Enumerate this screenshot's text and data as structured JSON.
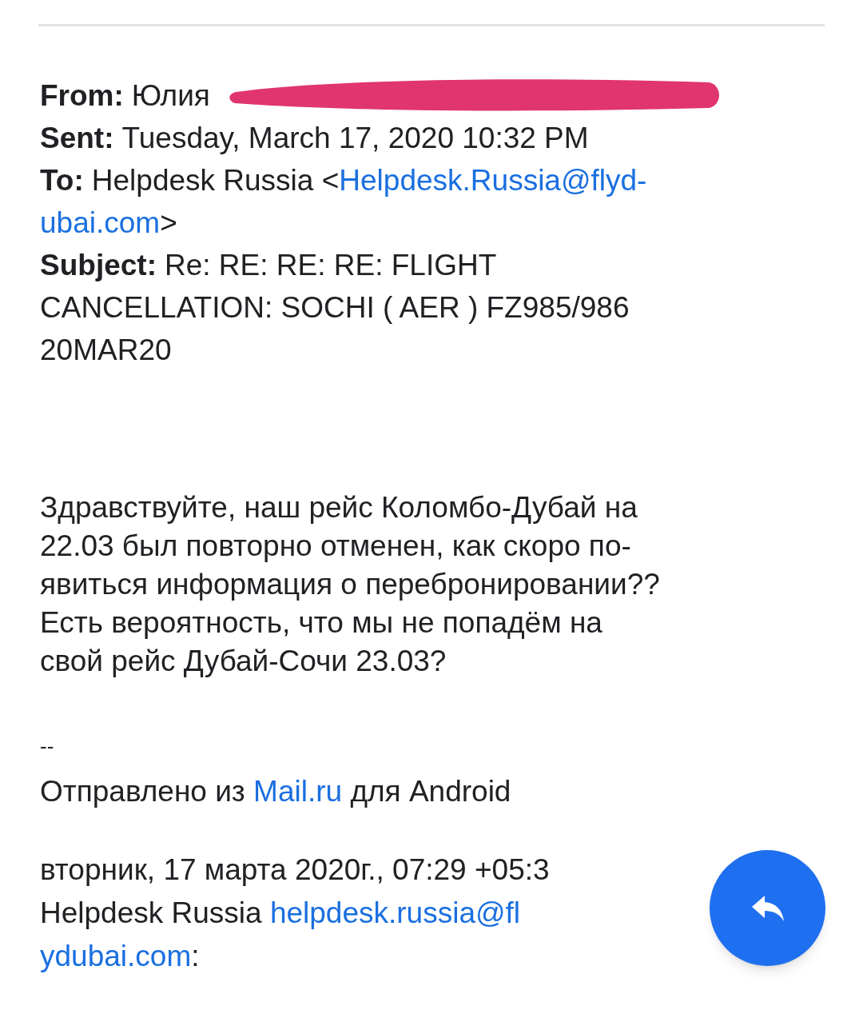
{
  "header": [
    {
      "redacted": true,
      "segments": [
        {
          "kind": "label",
          "text": "From:"
        },
        {
          "kind": "text",
          "text": "Юлия"
        }
      ]
    },
    {
      "redacted": false,
      "segments": [
        {
          "kind": "label",
          "text": "Sent:"
        },
        {
          "kind": "text",
          "text": "Tuesday, March 17, 2020 10:32 PM"
        }
      ]
    },
    {
      "redacted": false,
      "segments": [
        {
          "kind": "label",
          "text": "To:"
        },
        {
          "kind": "text",
          "text": "Helpdesk Russia <"
        },
        {
          "kind": "link",
          "text": "Helpdesk.Russia@flyd-"
        }
      ]
    },
    {
      "redacted": false,
      "segments": [
        {
          "kind": "link",
          "text": "ubai.com"
        },
        {
          "kind": "text",
          "text": ">"
        }
      ]
    },
    {
      "redacted": false,
      "segments": [
        {
          "kind": "label",
          "text": "Subject:"
        },
        {
          "kind": "text",
          "text": "Re: RE: RE: RE: FLIGHT"
        }
      ]
    },
    {
      "redacted": false,
      "segments": [
        {
          "kind": "text",
          "text": "CANCELLATION: SOCHI ( AER ) FZ985/986"
        }
      ]
    },
    {
      "redacted": false,
      "segments": [
        {
          "kind": "text",
          "text": "20MAR20"
        }
      ]
    }
  ],
  "body": [
    "Здравствуйте, наш рейс Коломбо-Дубай на",
    "22.03 был повторно отменен, как скоро по-",
    "явиться информация о перебронировании??",
    "Есть вероятность, что мы не попадём на",
    "свой рейс Дубай-Сочи 23.03?"
  ],
  "signature_separator": "--",
  "signature": [
    {
      "kind": "text",
      "text": "Отправлено из "
    },
    {
      "kind": "link",
      "text": "Mail.ru"
    },
    {
      "kind": "text",
      "text": " для Android"
    }
  ],
  "quote_intro": [
    [
      {
        "kind": "text",
        "text": "вторник, 17 марта 2020г., 07:29 +05:3"
      }
    ],
    [
      {
        "kind": "text",
        "text": "Helpdesk Russia "
      },
      {
        "kind": "link",
        "text": "helpdesk.russia@fl"
      }
    ],
    [
      {
        "kind": "link",
        "text": "ydubai.com"
      },
      {
        "kind": "text",
        "text": ":"
      }
    ]
  ]
}
